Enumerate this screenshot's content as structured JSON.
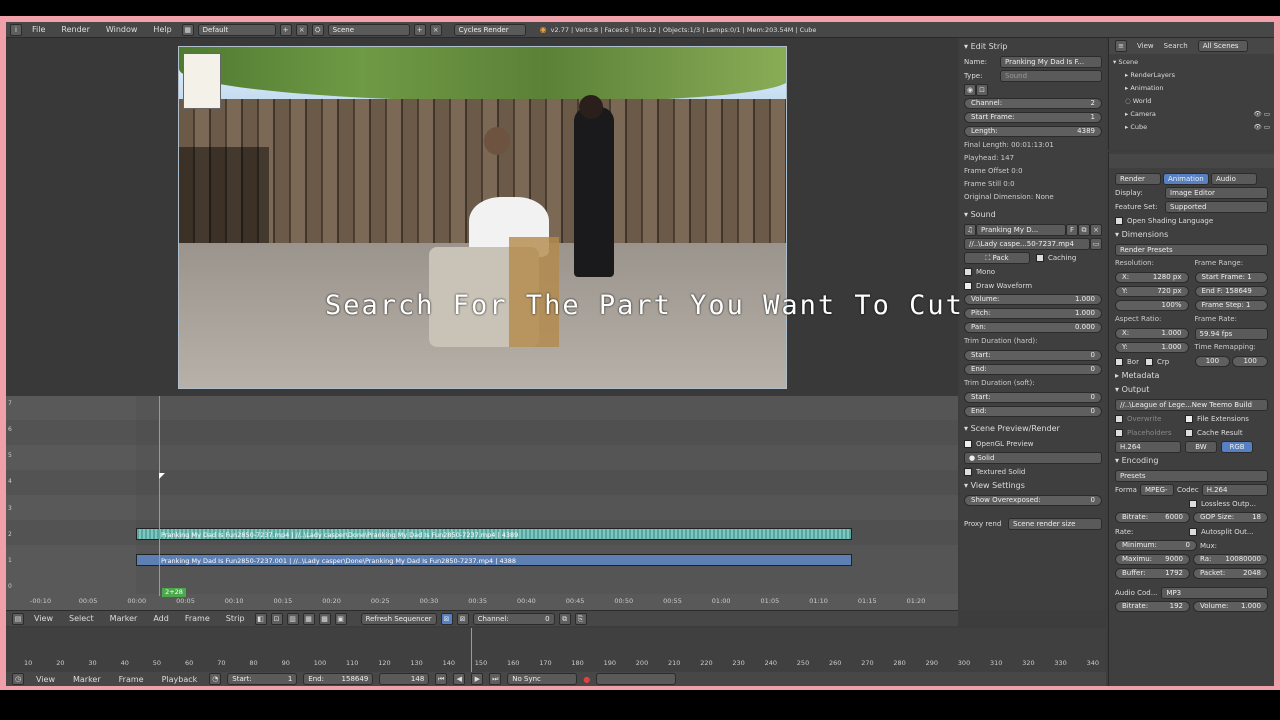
{
  "topbar": {
    "menus": [
      "File",
      "Render",
      "Window",
      "Help"
    ],
    "layout": "Default",
    "scene": "Scene",
    "engine": "Cycles Render",
    "stats": "v2.77 | Verts:8 | Faces:6 | Tris:12 | Objects:1/3 | Lamps:0/1 | Mem:203.54M | Cube"
  },
  "preview": {
    "overlay_text": "Search For The Part You Want To Cut"
  },
  "sequencer": {
    "channel_numbers": [
      "7",
      "6",
      "5",
      "4",
      "3",
      "2",
      "1",
      "0"
    ],
    "strips": [
      {
        "label": "Pranking My Dad Is Fun2850-7237.mp4 | //..\\Lady casper\\Done\\Pranking My Dad Is Fun2850-7237.mp4 | 4389",
        "type": "sound"
      },
      {
        "label": "Pranking My Dad Is Fun2850-7237.001 | //..\\Lady casper\\Done\\Pranking My Dad Is Fun2850-7237.mp4 | 4388",
        "type": "movie"
      }
    ],
    "frame_marker": "2+28",
    "ruler": [
      "-00:10",
      "00:05",
      "00:00",
      "00:05",
      "00:10",
      "00:15",
      "00:20",
      "00:25",
      "00:30",
      "00:35",
      "00:40",
      "00:45",
      "00:50",
      "00:55",
      "01:00",
      "01:05",
      "01:10",
      "01:15",
      "01:20"
    ],
    "header": {
      "menus": [
        "View",
        "Select",
        "Marker",
        "Add",
        "Frame",
        "Strip"
      ],
      "refresh": "Refresh Sequencer",
      "channel_label": "Channel:",
      "channel_value": "0"
    }
  },
  "timeline": {
    "ruler": [
      "10",
      "20",
      "30",
      "40",
      "50",
      "60",
      "70",
      "80",
      "90",
      "100",
      "110",
      "120",
      "130",
      "140",
      "150",
      "160",
      "170",
      "180",
      "190",
      "200",
      "210",
      "220",
      "230",
      "240",
      "250",
      "260",
      "270",
      "280",
      "290",
      "300",
      "310",
      "320",
      "330",
      "340"
    ],
    "header": {
      "menus": [
        "View",
        "Marker",
        "Frame",
        "Playback"
      ],
      "start_label": "Start:",
      "start_value": "1",
      "end_label": "End:",
      "end_value": "158649",
      "current": "148",
      "sync": "No Sync"
    }
  },
  "edit_strip": {
    "title": "Edit Strip",
    "name_label": "Name:",
    "name_value": "Pranking My Dad Is F...",
    "type_label": "Type:",
    "type_value": "Sound",
    "channel_label": "Channel:",
    "channel_value": "2",
    "start_label": "Start Frame:",
    "start_value": "1",
    "length_label": "Length:",
    "length_value": "4389",
    "info": [
      "Final Length: 00:01:13:01",
      "Playhead: 147",
      "Frame Offset 0:0",
      "Frame Still 0:0",
      "Original Dimension: None"
    ]
  },
  "sound": {
    "title": "Sound",
    "file": "Pranking My D...",
    "f_label": "F",
    "path": "//..\\Lady caspe...50-7237.mp4",
    "pack": "Pack",
    "caching": "Caching",
    "mono": "Mono",
    "draw_waveform": "Draw Waveform",
    "volume_label": "Volume:",
    "volume_value": "1.000",
    "pitch_label": "Pitch:",
    "pitch_value": "1.000",
    "pan_label": "Pan:",
    "pan_value": "0.000",
    "trim_hard": "Trim Duration (hard):",
    "trim_soft": "Trim Duration (soft):",
    "start_label": "Start:",
    "end_label": "End:",
    "zero": "0"
  },
  "scene_preview": {
    "title": "Scene Preview/Render",
    "opengl": "OpenGL Preview",
    "shading": "Solid",
    "textured": "Textured Solid"
  },
  "view_settings": {
    "title": "View Settings",
    "overexposed_label": "Show Overexposed:",
    "overexposed_value": "0",
    "proxy_label": "Proxy rend",
    "proxy_value": "Scene render size"
  },
  "outliner": {
    "header": [
      "View",
      "Search",
      "All Scenes"
    ],
    "items": [
      "Scene",
      "RenderLayers",
      "Animation",
      "World",
      "Camera",
      "Cube"
    ]
  },
  "render_props": {
    "tabs": [
      "Render",
      "Animation",
      "Audio"
    ],
    "display_label": "Display:",
    "display_value": "Image Editor",
    "feature_label": "Feature Set:",
    "feature_value": "Supported",
    "osl": "Open Shading Language",
    "dimensions": "Dimensions",
    "presets": "Render Presets",
    "resolution": "Resolution:",
    "res_x": "1280 px",
    "res_y": "720 px",
    "res_pct": "100%",
    "frame_range": "Frame Range:",
    "start_frame": "Start Frame: 1",
    "end_frame": "End F: 158649",
    "frame_step": "Frame Step: 1",
    "aspect": "Aspect Ratio:",
    "aspect_x": "1.000",
    "aspect_y": "1.000",
    "frame_rate": "Frame Rate:",
    "fps": "59.94 fps",
    "bor": "Bor",
    "crop": "Crp",
    "time_remap": "Time Remapping:",
    "remap_old": "100",
    "remap_new": "100",
    "metadata": "Metadata",
    "output": "Output",
    "output_path": "//..\\League of Lege...New Teemo Build",
    "overwrite": "Overwrite",
    "file_ext": "File Extensions",
    "placeholders": "Placeholders",
    "cache_result": "Cache Result",
    "format": "H.264",
    "bw": "BW",
    "rgb": "RGB",
    "encoding": "Encoding",
    "enc_presets": "Presets",
    "forma_label": "Forma",
    "forma_value": "MPEG-",
    "codec_label": "Codec",
    "codec_value": "H.264",
    "lossless": "Lossless Outp...",
    "bitrate_label": "Bitrate:",
    "bitrate_value": "6000",
    "gop_label": "GOP Size:",
    "gop_value": "18",
    "rate": "Rate:",
    "autosplit": "Autosplit Out...",
    "min_label": "Minimum:",
    "min_value": "0",
    "mux": "Mux:",
    "max_label": "Maximu:",
    "max_value": "9000",
    "ra_label": "Ra:",
    "ra_value": "10080000",
    "buffer_label": "Buffer:",
    "buffer_value": "1792",
    "packet_label": "Packet:",
    "packet_value": "2048",
    "audio_codec_label": "Audio Cod...",
    "audio_codec_value": "MP3",
    "abitrate_label": "Bitrate:",
    "abitrate_value": "192",
    "avolume_label": "Volume:",
    "avolume_value": "1.000"
  }
}
